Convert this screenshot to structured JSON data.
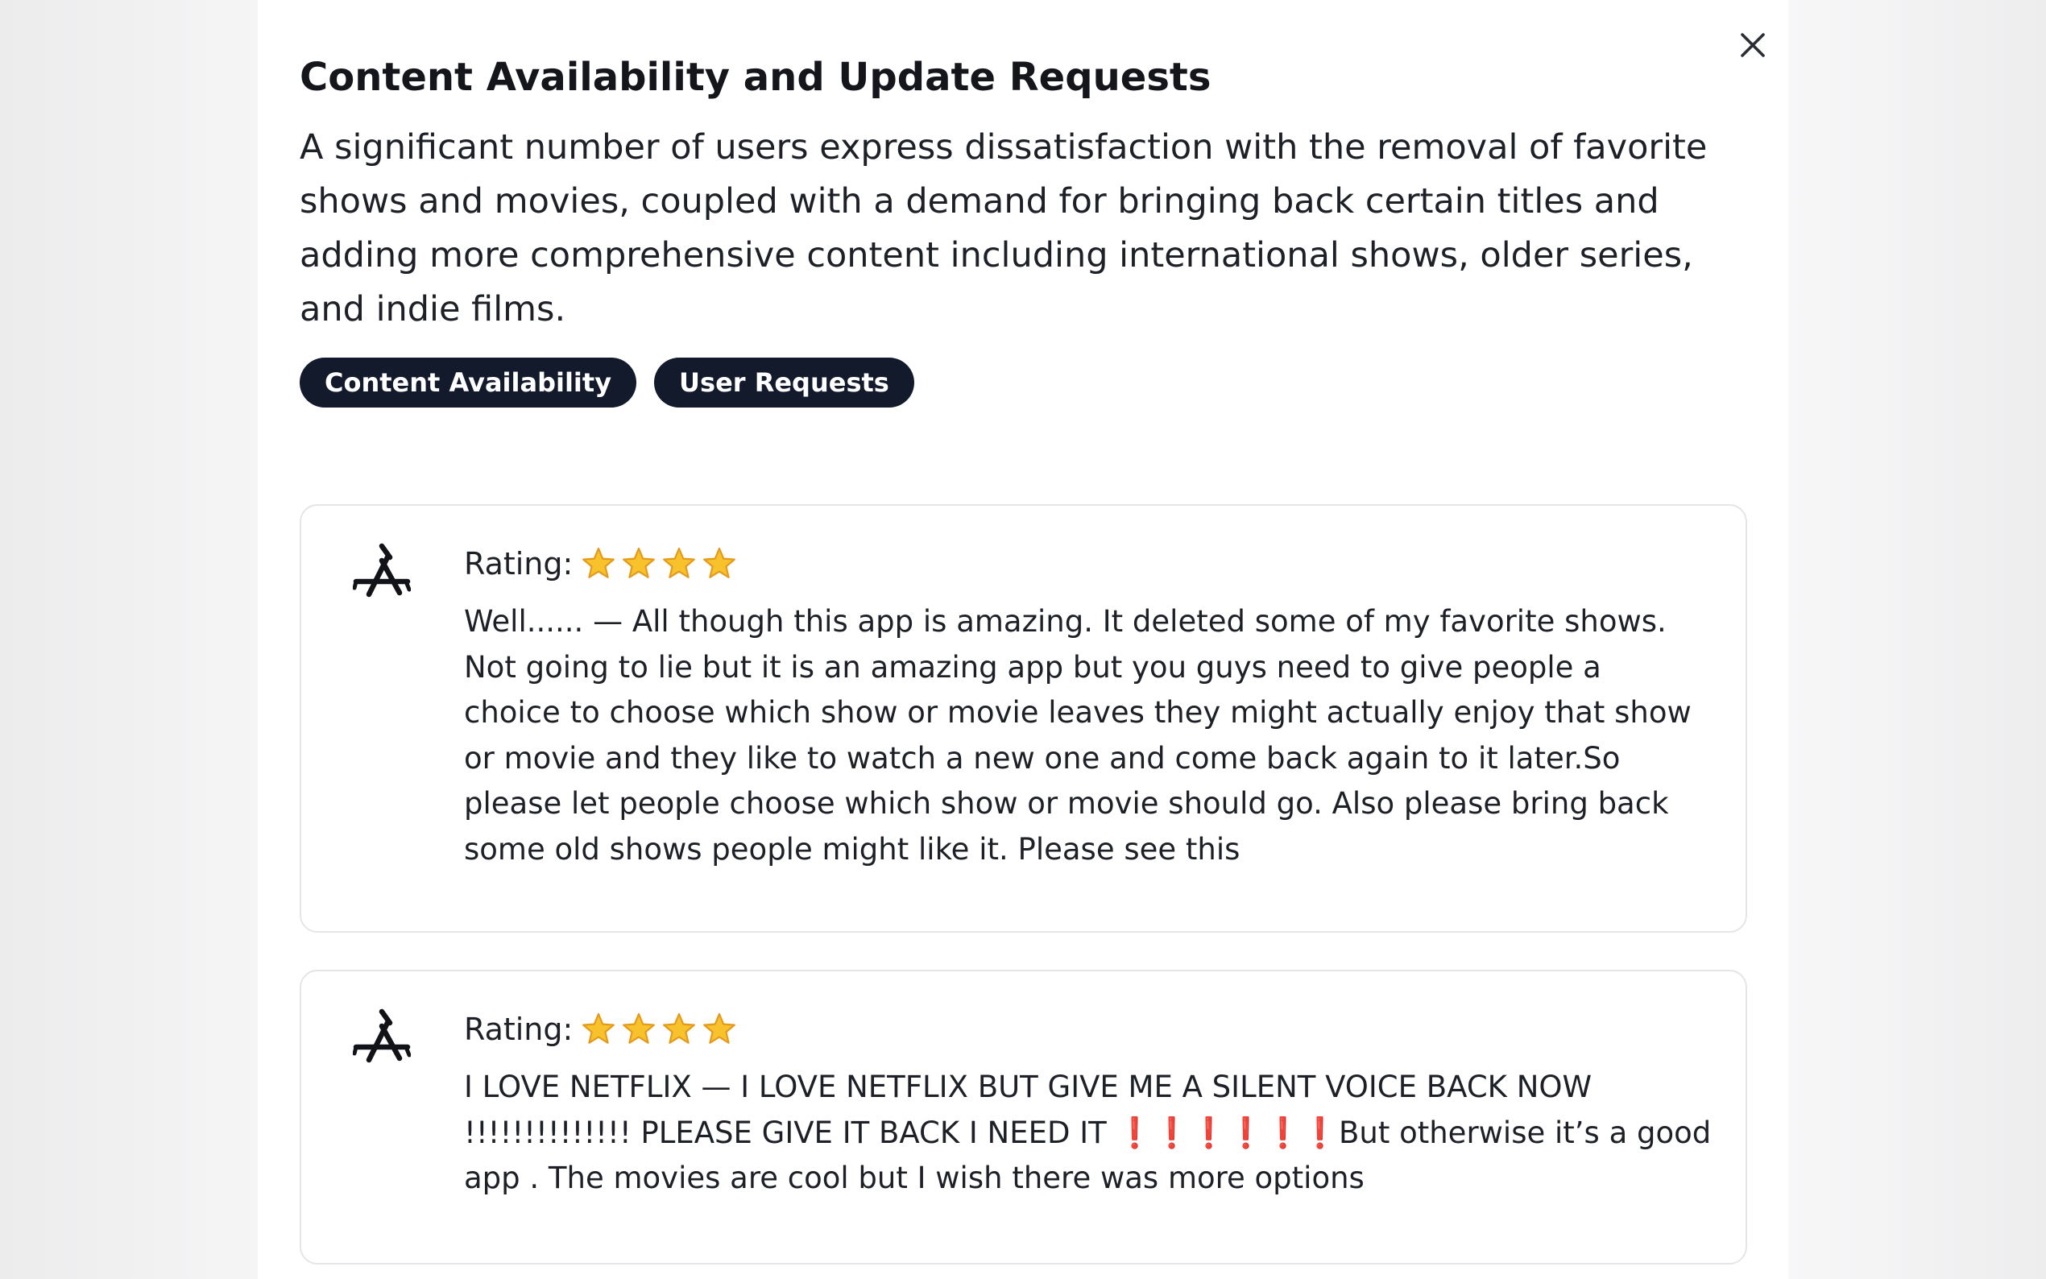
{
  "modal": {
    "title": "Content Availability and Update Requests",
    "description": "A significant number of users express dissatisfaction with the removal of favorite shows and movies, coupled with a demand for bringing back certain titles and adding more comprehensive content including international shows, older series, and indie films.",
    "close_icon": "close-icon",
    "tags": [
      {
        "label": "Content Availability"
      },
      {
        "label": "User Requests"
      }
    ]
  },
  "reviews": [
    {
      "source_icon": "app-store-icon",
      "rating_label": "Rating:",
      "stars": 4,
      "text": "Well...... — All though this app is amazing. It deleted some of my favorite shows.\nNot going to lie but it is an amazing app but you guys need to give people a\nchoice to choose which show or movie leaves they might actually enjoy that show\nor movie and they like to watch a new one and come back again to it later.So\nplease let people choose which show or movie should go. Also please bring back\nsome old shows people might like it. Please see this"
    },
    {
      "source_icon": "app-store-icon",
      "rating_label": "Rating:",
      "stars": 4,
      "text": "I LOVE NETFLIX — I LOVE NETFLIX BUT GIVE ME A SILENT VOICE BACK NOW\n!!!!!!!!!!!!!! PLEASE GIVE IT BACK I NEED IT ❗❗❗❗❗❗But otherwise it’s a good\napp . The movies are cool but I wish there was more options"
    }
  ],
  "colors": {
    "tag_background": "#121a2c",
    "star_fill": "#f7c22c",
    "star_outline": "#e59a1a",
    "exclamation": "#e0251c"
  }
}
